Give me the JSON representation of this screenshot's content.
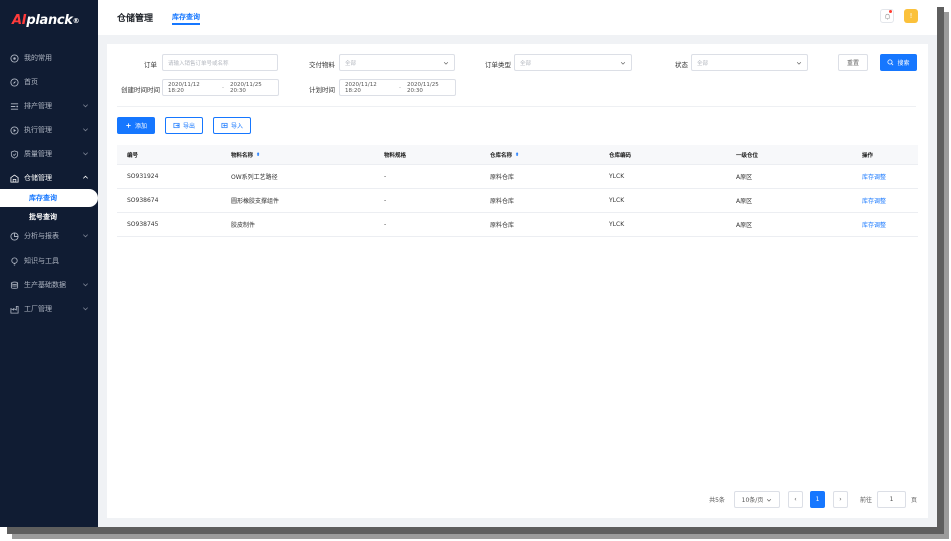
{
  "app": {
    "logo_brand_prefix": "AI",
    "logo_brand_suffix": "planck",
    "logo_mark": "®"
  },
  "sidebar": {
    "items": [
      {
        "label": "我的常用",
        "icon": "star-circle-icon"
      },
      {
        "label": "首页",
        "icon": "compass-icon"
      },
      {
        "label": "排产管理",
        "icon": "schedule-icon",
        "has_children": true
      },
      {
        "label": "执行管理",
        "icon": "play-circle-icon",
        "has_children": true
      },
      {
        "label": "质量管理",
        "icon": "shield-check-icon",
        "has_children": true
      },
      {
        "label": "仓储管理",
        "icon": "warehouse-icon",
        "has_children": true,
        "expanded": true
      },
      {
        "label": "分析与报表",
        "icon": "chart-icon",
        "has_children": true
      },
      {
        "label": "知识与工具",
        "icon": "bulb-icon"
      },
      {
        "label": "生产基础数据",
        "icon": "database-icon",
        "has_children": true
      },
      {
        "label": "工厂管理",
        "icon": "factory-icon",
        "has_children": true
      }
    ],
    "sub_items": [
      {
        "label": "库存查询",
        "active": true
      },
      {
        "label": "批号查询",
        "active": false
      }
    ]
  },
  "header": {
    "module_title": "仓储管理",
    "active_tab": "库存查询",
    "avatar_initial": "!",
    "notification_icon": "bell-icon"
  },
  "filters": {
    "order_label": "订单",
    "order_placeholder": "请输入销售订单号或名称",
    "material_label": "交付物料",
    "material_value": "全部",
    "order_type_label": "订单类型",
    "order_type_value": "全部",
    "status_label": "状态",
    "status_value": "全部",
    "created_label": "创建时间时间",
    "created_start": "2020/11/12 18:20",
    "created_end": "2020/11/25 20:30",
    "planned_label": "计划时间",
    "planned_start": "2020/11/12 18:20",
    "planned_end": "2020/11/25 20:30",
    "range_separator": "-",
    "reset_label": "重置",
    "search_label": "搜索"
  },
  "actions": {
    "add_label": "添加",
    "export_label": "导出",
    "import_label": "导入"
  },
  "table": {
    "columns": [
      "编号",
      "物料名称",
      "物料规格",
      "仓库名称",
      "仓库编码",
      "一级仓位",
      "操作"
    ],
    "rows": [
      {
        "id": "SO931924",
        "name": "OW系列工艺路径",
        "spec": "-",
        "warehouse": "原料仓库",
        "code": "YLCK",
        "location": "A原区",
        "action": "库存调整"
      },
      {
        "id": "SO938674",
        "name": "圆形橡胶支撑组件",
        "spec": "-",
        "warehouse": "原料仓库",
        "code": "YLCK",
        "location": "A原区",
        "action": "库存调整"
      },
      {
        "id": "SO938745",
        "name": "胶皮制件",
        "spec": "-",
        "warehouse": "原料仓库",
        "code": "YLCK",
        "location": "A原区",
        "action": "库存调整"
      }
    ]
  },
  "pagination": {
    "total_text": "共5条",
    "page_size": "10条/页",
    "prev": "‹",
    "current_page": "1",
    "next": "›",
    "goto_label": "前往",
    "goto_value": "1",
    "page_suffix": "页"
  },
  "colors": {
    "accent": "#1677ff",
    "sidebar_bg": "#101c33",
    "logo_red": "#ff3b3b",
    "avatar": "#fbc13b"
  }
}
